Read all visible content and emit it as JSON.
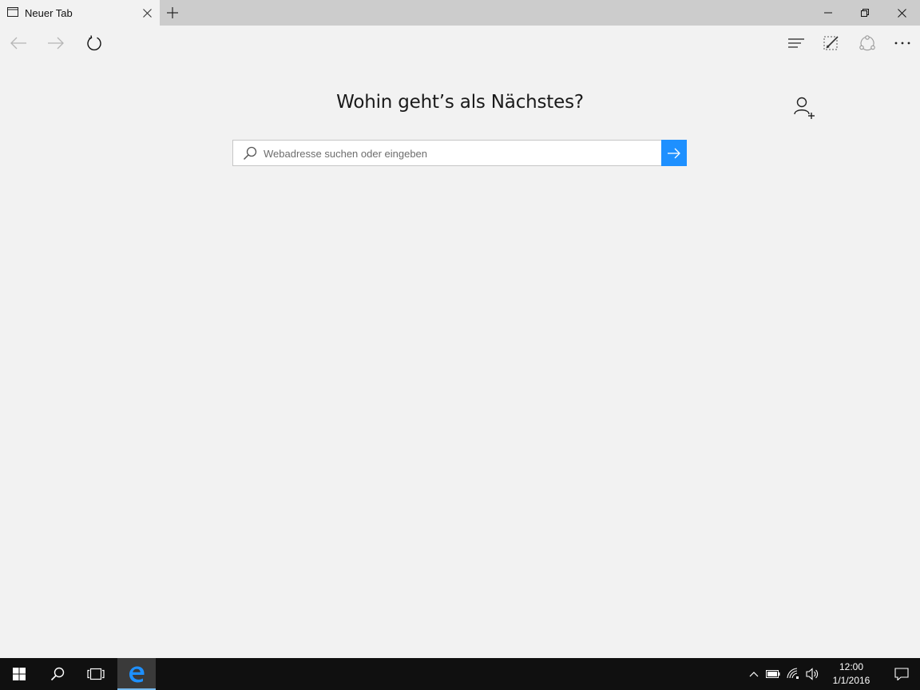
{
  "browser": {
    "tab": {
      "title": "Neuer Tab",
      "icon": "tab-page-icon"
    },
    "new_tab_icon": "plus-icon",
    "window_controls": [
      "minimize-icon",
      "restore-icon",
      "close-icon"
    ],
    "nav": {
      "back_icon": "back-arrow-icon",
      "forward_icon": "forward-arrow-icon",
      "refresh_icon": "refresh-icon",
      "right_icons": [
        "hub-icon",
        "web-note-icon",
        "share-icon",
        "more-icon"
      ]
    }
  },
  "main": {
    "heading": "Wohin geht’s als Nächstes?",
    "search": {
      "placeholder": "Webadresse suchen oder eingeben",
      "value": ""
    },
    "add_user_icon": "add-user-icon",
    "go_icon": "arrow-right-icon"
  },
  "taskbar": {
    "items": [
      "windows-start-icon",
      "search-icon",
      "task-view-icon",
      "edge-icon"
    ],
    "tray": [
      "chevron-up-icon",
      "battery-icon",
      "wifi-icon",
      "volume-icon"
    ],
    "clock": {
      "time": "12:00",
      "date": "1/1/2016"
    },
    "notification_icon": "action-center-icon"
  },
  "colors": {
    "accent": "#1e90ff",
    "taskbar": "#101010",
    "background": "#f2f2f2",
    "tabstrip": "#cccccc"
  }
}
